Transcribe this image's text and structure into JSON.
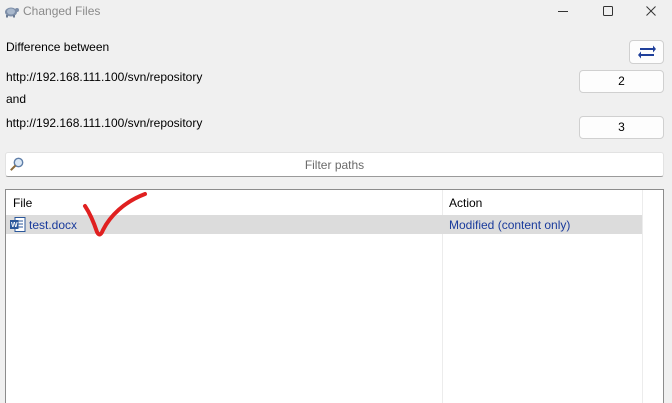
{
  "window": {
    "title": "Changed Files"
  },
  "compare": {
    "heading": "Difference between",
    "url_from": "http://192.168.111.100/svn/repository",
    "and_label": "and",
    "url_to": "http://192.168.111.100/svn/repository",
    "rev_from": "2",
    "rev_to": "3"
  },
  "filter": {
    "placeholder": "Filter paths"
  },
  "list": {
    "columns": [
      "File",
      "Action"
    ],
    "rows": [
      {
        "file": "test.docx",
        "action": "Modified (content only)",
        "icon": "word-document-icon"
      }
    ]
  },
  "colors": {
    "link_text": "#1a3b9c",
    "selected_row": "#dcdcdc",
    "annotation": "#e02020"
  }
}
